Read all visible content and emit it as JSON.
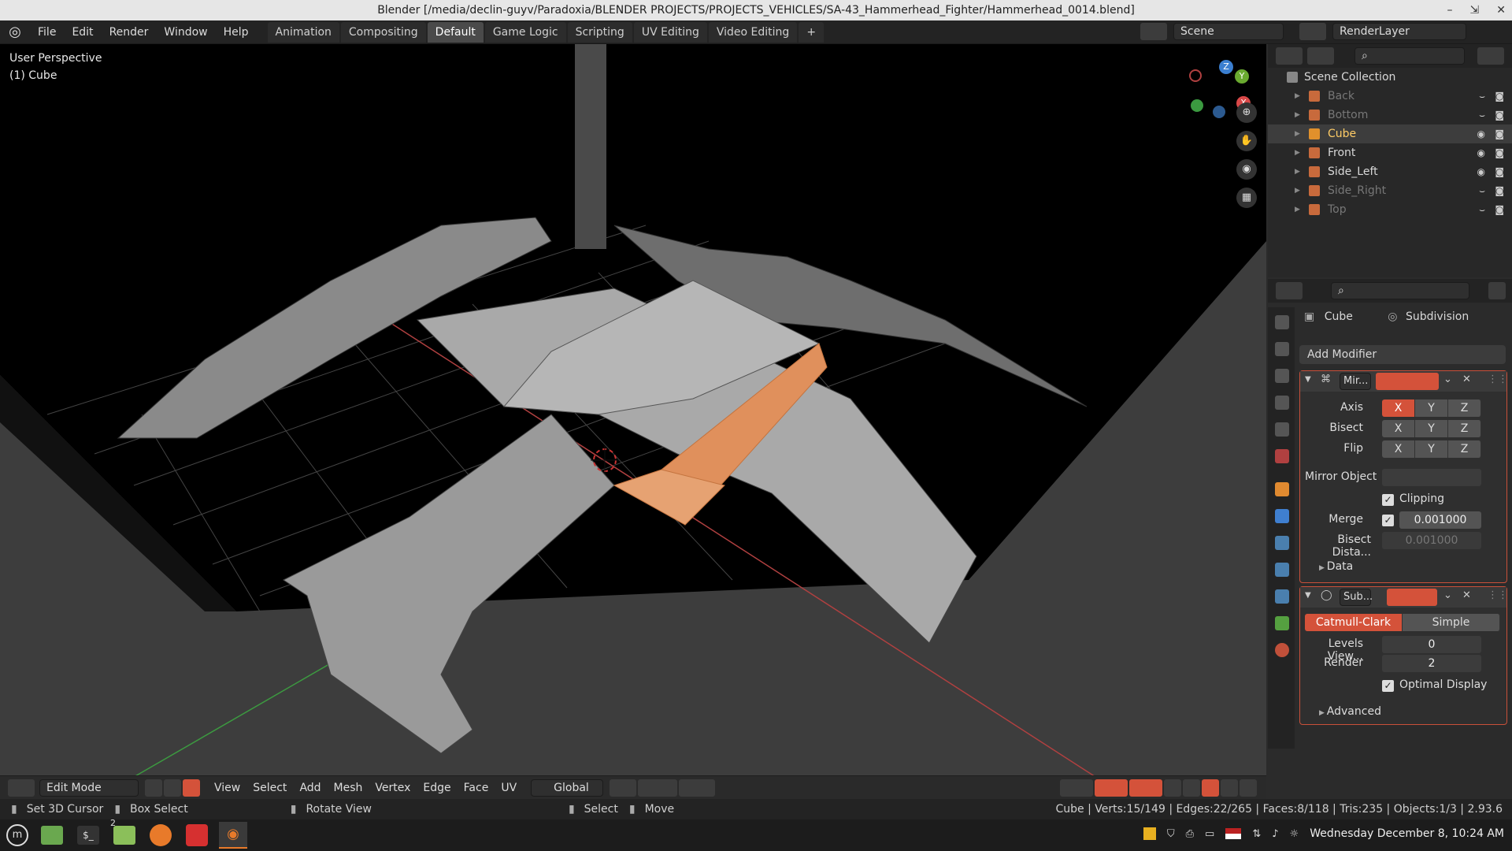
{
  "window": {
    "title": "Blender [/media/declin-guyv/Paradoxia/BLENDER PROJECTS/PROJECTS_VEHICLES/SA-43_Hammerhead_Fighter/Hammerhead_0014.blend]"
  },
  "menubar": {
    "items": [
      "File",
      "Edit",
      "Render",
      "Window",
      "Help"
    ]
  },
  "workspaces": {
    "tabs": [
      "Animation",
      "Compositing",
      "Default",
      "Game Logic",
      "Scripting",
      "UV Editing",
      "Video Editing"
    ],
    "active": "Default",
    "add": "+"
  },
  "scene": {
    "name": "Scene",
    "render_layer": "RenderLayer"
  },
  "viewport": {
    "perspective": "User Perspective",
    "object": "(1) Cube",
    "gizmo": {
      "x": "X",
      "y": "Y",
      "z": "Z"
    }
  },
  "outliner": {
    "collection": "Scene Collection",
    "items": [
      {
        "name": "Back",
        "visible": false
      },
      {
        "name": "Bottom",
        "visible": false
      },
      {
        "name": "Cube",
        "visible": true,
        "active": true
      },
      {
        "name": "Front",
        "visible": true
      },
      {
        "name": "Side_Left",
        "visible": true
      },
      {
        "name": "Side_Right",
        "visible": false
      },
      {
        "name": "Top",
        "visible": false
      }
    ]
  },
  "properties": {
    "object": "Cube",
    "modifier_context": "Subdivision",
    "add_modifier": "Add Modifier",
    "mirror": {
      "name": "Mir...",
      "axis_label": "Axis",
      "bisect_label": "Bisect",
      "flip_label": "Flip",
      "x": "X",
      "y": "Y",
      "z": "Z",
      "mirror_object_label": "Mirror Object",
      "clipping_label": "Clipping",
      "merge_label": "Merge",
      "merge_value": "0.001000",
      "bisect_distance_label": "Bisect Dista...",
      "bisect_distance_value": "0.001000",
      "data_label": "Data"
    },
    "subsurf": {
      "name": "Sub...",
      "catmull": "Catmull-Clark",
      "simple": "Simple",
      "levels_label": "Levels View...",
      "levels_value": "0",
      "render_label": "Render",
      "render_value": "2",
      "optimal_label": "Optimal Display",
      "advanced_label": "Advanced"
    }
  },
  "viewport_header": {
    "mode": "Edit Mode",
    "menus": [
      "View",
      "Select",
      "Add",
      "Mesh",
      "Vertex",
      "Edge",
      "Face",
      "UV"
    ],
    "orientation": "Global"
  },
  "statusbar": {
    "left": [
      {
        "action": "Set 3D Cursor"
      },
      {
        "action": "Box Select"
      },
      {
        "action": "Rotate View"
      },
      {
        "action": "Select"
      },
      {
        "action": "Move"
      }
    ],
    "stats": "Cube | Verts:15/149 | Edges:22/265 | Faces:8/118 | Tris:235 | Objects:1/3 | 2.93.6"
  },
  "taskbar": {
    "clock": "Wednesday December  8, 10:24 AM",
    "badge": "2"
  },
  "colors": {
    "accent": "#d4523a",
    "selected_face": "#e0905c",
    "mesh": "#a9a9a9",
    "floor_dark": "#000000",
    "viewport_bg": "#3d3d3d"
  }
}
